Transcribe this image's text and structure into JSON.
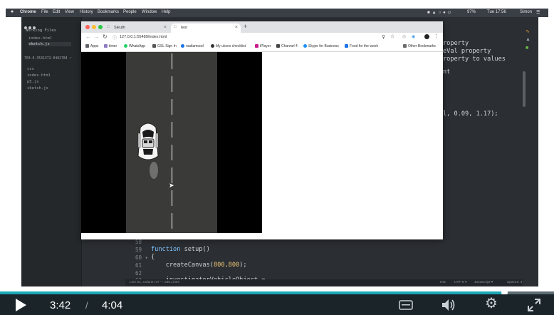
{
  "menubar": {
    "apple": "",
    "app": "Chrome",
    "menus": [
      "File",
      "Edit",
      "View",
      "History",
      "Bookmarks",
      "People",
      "Window",
      "Help"
    ],
    "battery": "97%",
    "clock": "Tue 17:56",
    "user": "Simon"
  },
  "editor": {
    "sidebar": {
      "working_files_label": "Working Files",
      "working_files": [
        "index.html",
        "sketch.js"
      ],
      "project_label": "703-0-3531372-0402784 ~",
      "project_items": [
        "css",
        "index.html",
        "p5.js",
        "sketch.js"
      ]
    },
    "code_right": [
      "roperty",
      "eVal property",
      "roperty to values",
      "nt",
      "l, 0.09, 1.17);"
    ],
    "line_numbers": [
      "58",
      "59",
      "60 ▾",
      "61",
      "62",
      "63"
    ],
    "code_lines": [
      {
        "kw": "",
        "text": ""
      },
      {
        "kw": "function",
        "text": " setup()"
      },
      {
        "kw": "",
        "text": "{"
      },
      {
        "kw": "",
        "text": "    createCanvas(",
        "num": "800,800",
        "end": ");"
      },
      {
        "kw": "",
        "text": ""
      },
      {
        "kw": "",
        "text": "    investigatorVehicleObject ="
      }
    ],
    "status": {
      "position": "Line 61, Column 47 — 235 Lines",
      "encoding": "UTF-8 ▾",
      "language": "JavaScript ▾",
      "spaces": "Spaces: 4"
    }
  },
  "chrome": {
    "tabs": [
      {
        "label": "Sleuth"
      },
      {
        "label": "test"
      }
    ],
    "new_tab": "+",
    "url": "127.0.0.1:55489/index.html",
    "bookmarks": [
      {
        "label": "Apps",
        "color": "#5f6368"
      },
      {
        "label": "timer",
        "color": "#8e7cc3"
      },
      {
        "label": "WhatsApp",
        "color": "#25d366"
      },
      {
        "label": "GSL Sign In",
        "color": "#555555"
      },
      {
        "label": "nadiamood",
        "color": "#1a73e8"
      },
      {
        "label": "My ulcers checklist",
        "color": "#333333"
      },
      {
        "label": "iPlayer",
        "color": "#c51d8a"
      },
      {
        "label": "Channel 4",
        "color": "#444444"
      },
      {
        "label": "Skype for Business",
        "color": "#1e90ff"
      },
      {
        "label": "Food for the week",
        "color": "#1a73e8"
      }
    ],
    "other_bookmarks": "Other Bookmarks"
  },
  "video": {
    "current_time": "3:42",
    "separator": "/",
    "duration": "4:04",
    "progress": 0.91,
    "accent": "#1aa7b8"
  }
}
